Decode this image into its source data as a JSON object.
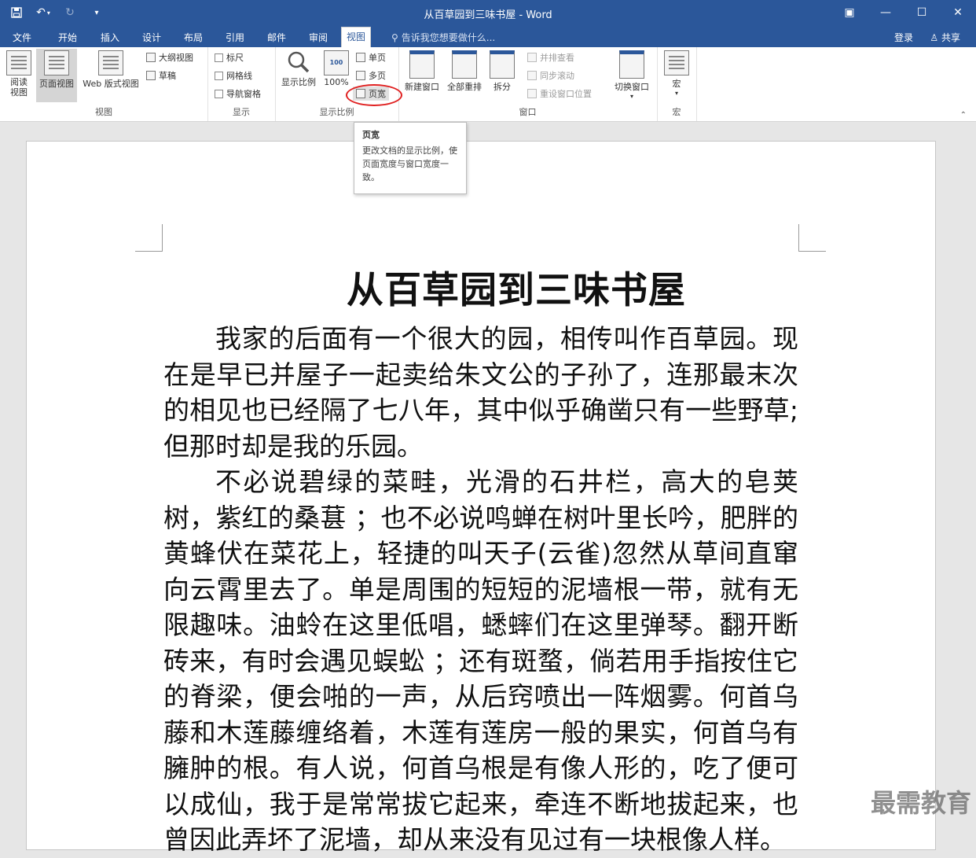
{
  "window": {
    "title": "从百草园到三味书屋 - Word",
    "quick_access": {
      "save_icon": "save-icon",
      "undo_icon": "undo-icon",
      "redo_icon": "redo-icon",
      "customize_icon": "customize-icon"
    },
    "controls": {
      "ribbon_options": "▣",
      "minimize": "—",
      "maximize": "☐",
      "close": "✕"
    }
  },
  "tabs": {
    "items": [
      "文件",
      "开始",
      "插入",
      "设计",
      "布局",
      "引用",
      "邮件",
      "审阅",
      "视图"
    ],
    "active": "视图",
    "tell_me": "告诉我您想要做什么...",
    "login": "登录",
    "share": "共享"
  },
  "ribbon": {
    "view_group": {
      "label": "视图",
      "read_mode": "阅读\n视图",
      "print_layout": "页面视图",
      "web_layout": "Web 版式视图",
      "outline": "大纲视图",
      "draft": "草稿"
    },
    "show_group": {
      "label": "显示",
      "ruler": "标尺",
      "gridlines": "网格线",
      "nav_pane": "导航窗格"
    },
    "zoom_group": {
      "label": "显示比例",
      "zoom": "显示比例",
      "hundred": "100%",
      "one_page": "单页",
      "multi_page": "多页",
      "page_width": "页宽"
    },
    "window_group": {
      "label": "窗口",
      "new_window": "新建窗口",
      "arrange_all": "全部重排",
      "split": "拆分",
      "side_by_side": "并排查看",
      "sync_scroll": "同步滚动",
      "reset_position": "重设窗口位置",
      "switch_windows": "切换窗口"
    },
    "macros_group": {
      "label": "宏",
      "macros": "宏"
    }
  },
  "tooltip": {
    "title": "页宽",
    "body": "更改文档的显示比例，使页面宽度与窗口宽度一致。"
  },
  "document": {
    "title": "从百草园到三味书屋",
    "paragraphs": [
      "我家的后面有一个很大的园，相传叫作百草园。现在是早已并屋子一起卖给朱文公的子孙了，连那最末次的相见也已经隔了七八年，其中似乎确凿只有一些野草;但那时却是我的乐园。",
      "不必说碧绿的菜畦，光滑的石井栏，高大的皂荚树，紫红的桑葚 ；也不必说鸣蝉在树叶里长吟，肥胖的黄蜂伏在菜花上，轻捷的叫天子(云雀)忽然从草间直窜向云霄里去了。单是周围的短短的泥墙根一带，就有无限趣味。油蛉在这里低唱，蟋蟀们在这里弹琴。翻开断砖来，有时会遇见蜈蚣 ；还有斑蝥，倘若用手指按住它的脊梁，便会啪的一声，从后窍喷出一阵烟雾。何首乌藤和木莲藤缠络着，木莲有莲房一般的果实，何首乌有臃肿的根。有人说，何首乌根是有像人形的，吃了便可以成仙，我于是常常拔它起来，牵连不断地拔起来，也曾因此弄坏了泥墙，却从来没有见过有一块根像人样。"
    ]
  },
  "watermark": "最需教育"
}
